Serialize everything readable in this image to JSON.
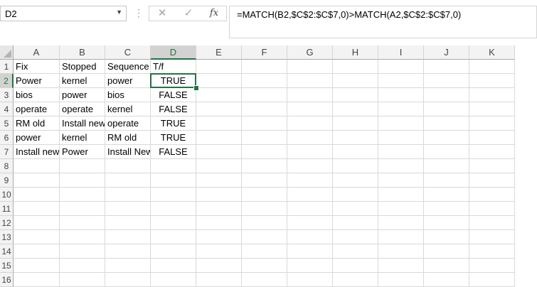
{
  "name_box": {
    "value": "D2",
    "dropdown_icon": "chevron-down-icon"
  },
  "formula_bar": {
    "cancel_glyph": "✕",
    "enter_glyph": "✓",
    "fx_label": "fx",
    "formula": "=MATCH(B2,$C$2:$C$7,0)>MATCH(A2,$C$2:$C$7,0)"
  },
  "columns": [
    "A",
    "B",
    "C",
    "D",
    "E",
    "F",
    "G",
    "H",
    "I",
    "J",
    "K"
  ],
  "rows": [
    "1",
    "2",
    "3",
    "4",
    "5",
    "6",
    "7",
    "8",
    "9",
    "10",
    "11",
    "12",
    "13",
    "14",
    "15",
    "16"
  ],
  "active_cell": "D2",
  "sheet": {
    "header_row": [
      "Fix",
      "Stopped",
      "Sequence",
      "T/f"
    ],
    "data_rows": [
      [
        "Power",
        "kernel",
        "power",
        "TRUE"
      ],
      [
        "bios",
        "power",
        "bios",
        "FALSE"
      ],
      [
        "operate",
        "operate",
        "kernel",
        "FALSE"
      ],
      [
        "RM old",
        "Install new",
        "operate",
        "TRUE"
      ],
      [
        "power",
        "kernel",
        "RM old",
        "TRUE"
      ],
      [
        "Install new",
        "Power",
        "Install New",
        "FALSE"
      ]
    ]
  }
}
